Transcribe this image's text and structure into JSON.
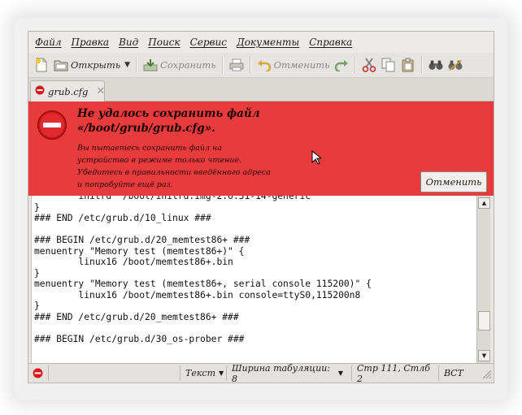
{
  "menu": [
    "Файл",
    "Правка",
    "Вид",
    "Поиск",
    "Сервис",
    "Документы",
    "Справка"
  ],
  "toolbar": {
    "open_label": "Открыть",
    "save_label": "Сохранить",
    "undo_label": "Отменить"
  },
  "tab": {
    "filename": "grub.cfg"
  },
  "error": {
    "title": "Не удалось сохранить файл «/boot/grub/grub.cfg».",
    "message": "Вы пытаетесь сохранить файл на устройство в режиме только чтение. Убедитесь в правильности введённого адреса и попробуйте ещё раз.",
    "cancel_label": "Отменить"
  },
  "editor": {
    "lines": [
      "        initrd  /boot/initrd.img-2.6.31-14-generic",
      "}",
      "### END /etc/grub.d/10_linux ###",
      "",
      "### BEGIN /etc/grub.d/20_memtest86+ ###",
      "menuentry \"Memory test (memtest86+)\" {",
      "        linux16 /boot/memtest86+.bin",
      "}",
      "menuentry \"Memory test (memtest86+, serial console 115200)\" {",
      "        linux16 /boot/memtest86+.bin console=ttyS0,115200n8",
      "}",
      "### END /etc/grub.d/20_memtest86+ ###",
      "",
      "### BEGIN /etc/grub.d/30_os-prober ###"
    ]
  },
  "status": {
    "language": "Текст",
    "tab_width": "Ширина табуляции: 8",
    "position": "Стр 111, Стлб 2",
    "insert_mode": "ВСТ"
  },
  "colors": {
    "error_bg": "#ea3b3c",
    "stop_icon": "#d9181b"
  }
}
